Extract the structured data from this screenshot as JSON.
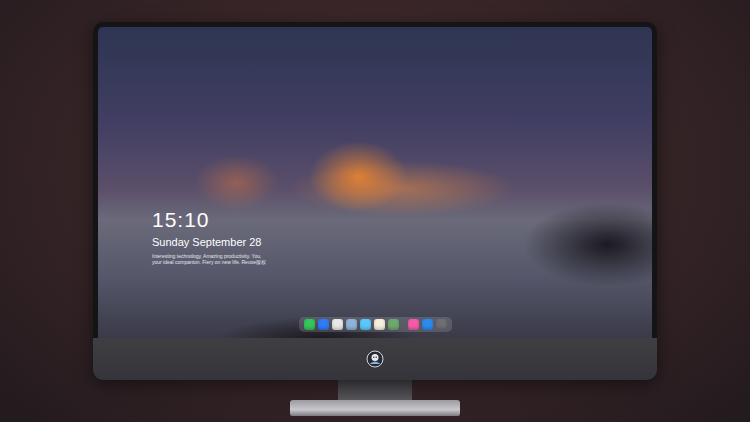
{
  "lock_screen": {
    "time": "15:10",
    "date": "Sunday September 28",
    "caption": [
      "Interesting technology, Amazing productivity. You,",
      "your ideal companion. Fiery on new life. Reuse版权"
    ]
  },
  "dock": {
    "apps": [
      {
        "color": "#34c759"
      },
      {
        "color": "#2f7cf6"
      },
      {
        "color": "#e8e8e8"
      },
      {
        "color": "#8fb3d9"
      },
      {
        "color": "#5ac8fa"
      },
      {
        "color": "#f5f0dc"
      },
      {
        "color": "#6fa86f"
      }
    ],
    "pinned": [
      {
        "color": "#f25ca8"
      },
      {
        "color": "#2b8cf0"
      },
      {
        "color": "#6e6e73"
      }
    ]
  }
}
